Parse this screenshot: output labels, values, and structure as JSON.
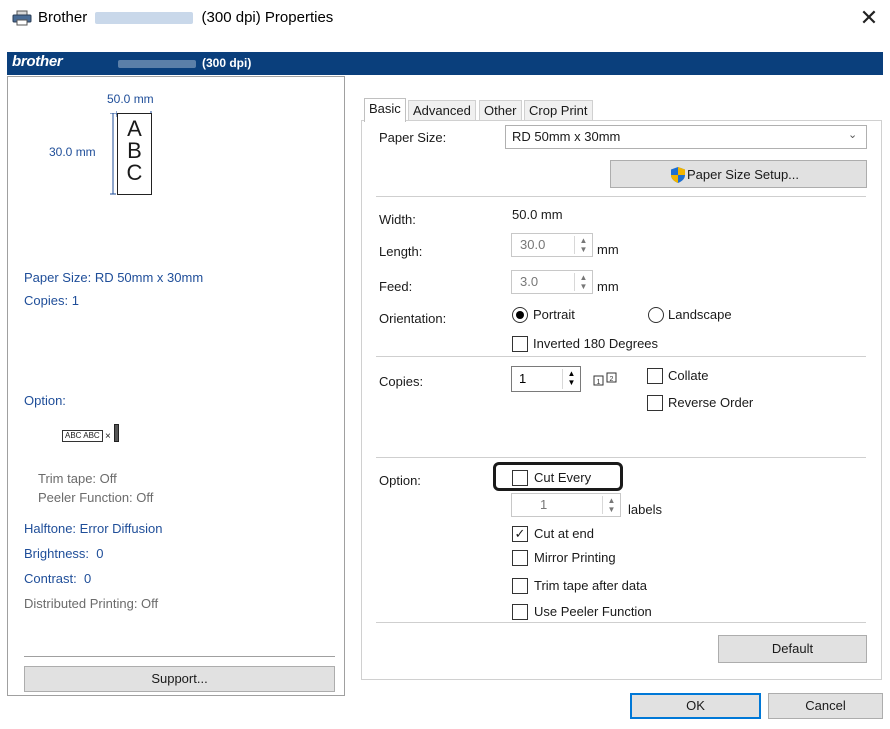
{
  "window": {
    "title_prefix": "Brother",
    "title_suffix": "(300 dpi) Properties",
    "brand_logo": "brother",
    "brand_dpi": "(300 dpi)"
  },
  "preview": {
    "width_label": "50.0 mm",
    "height_label": "30.0 mm",
    "sample_letters": [
      "A",
      "B",
      "C"
    ]
  },
  "summary": {
    "paper_size": "Paper Size: RD 50mm x 30mm",
    "copies": "Copies: 1",
    "option_label": "Option:",
    "option_icon_text": "ABC ABC",
    "trim_tape": "Trim tape: Off",
    "peeler": "Peeler Function: Off",
    "halftone": "Halftone: Error Diffusion",
    "brightness": "Brightness:  0",
    "contrast": "Contrast:  0",
    "distributed": "Distributed Printing: Off",
    "support_button": "Support..."
  },
  "tabs": [
    "Basic",
    "Advanced",
    "Other",
    "Crop Print"
  ],
  "basic": {
    "paper_size_label": "Paper Size:",
    "paper_size_value": "RD 50mm x 30mm",
    "paper_size_setup": "Paper Size Setup...",
    "width_label": "Width:",
    "width_value": "50.0 mm",
    "length_label": "Length:",
    "length_value": "30.0",
    "length_unit": "mm",
    "feed_label": "Feed:",
    "feed_value": "3.0",
    "feed_unit": "mm",
    "orientation_label": "Orientation:",
    "portrait": "Portrait",
    "landscape": "Landscape",
    "inverted": "Inverted 180 Degrees",
    "copies_label": "Copies:",
    "copies_value": "1",
    "collate": "Collate",
    "reverse_order": "Reverse Order",
    "option_label": "Option:",
    "cut_every": "Cut Every",
    "cut_every_value": "1",
    "labels_unit": "labels",
    "cut_at_end": "Cut at end",
    "mirror": "Mirror Printing",
    "trim_after": "Trim tape after data",
    "use_peeler": "Use Peeler Function",
    "default_button": "Default"
  },
  "footer": {
    "ok": "OK",
    "cancel": "Cancel"
  },
  "state": {
    "portrait_selected": true,
    "landscape_selected": false,
    "inverted_checked": false,
    "collate_checked": false,
    "reverse_checked": false,
    "cut_every_checked": false,
    "cut_at_end_checked": true,
    "mirror_checked": false,
    "trim_after_checked": false,
    "use_peeler_checked": false
  },
  "colors": {
    "brand_bar": "#0a3f7c",
    "summary_text": "#1f4e99",
    "disabled_text": "#6b6b6b",
    "ok_focus": "#0078d7",
    "shield_blue": "#1d6fd1",
    "shield_gold": "#f0b400"
  }
}
